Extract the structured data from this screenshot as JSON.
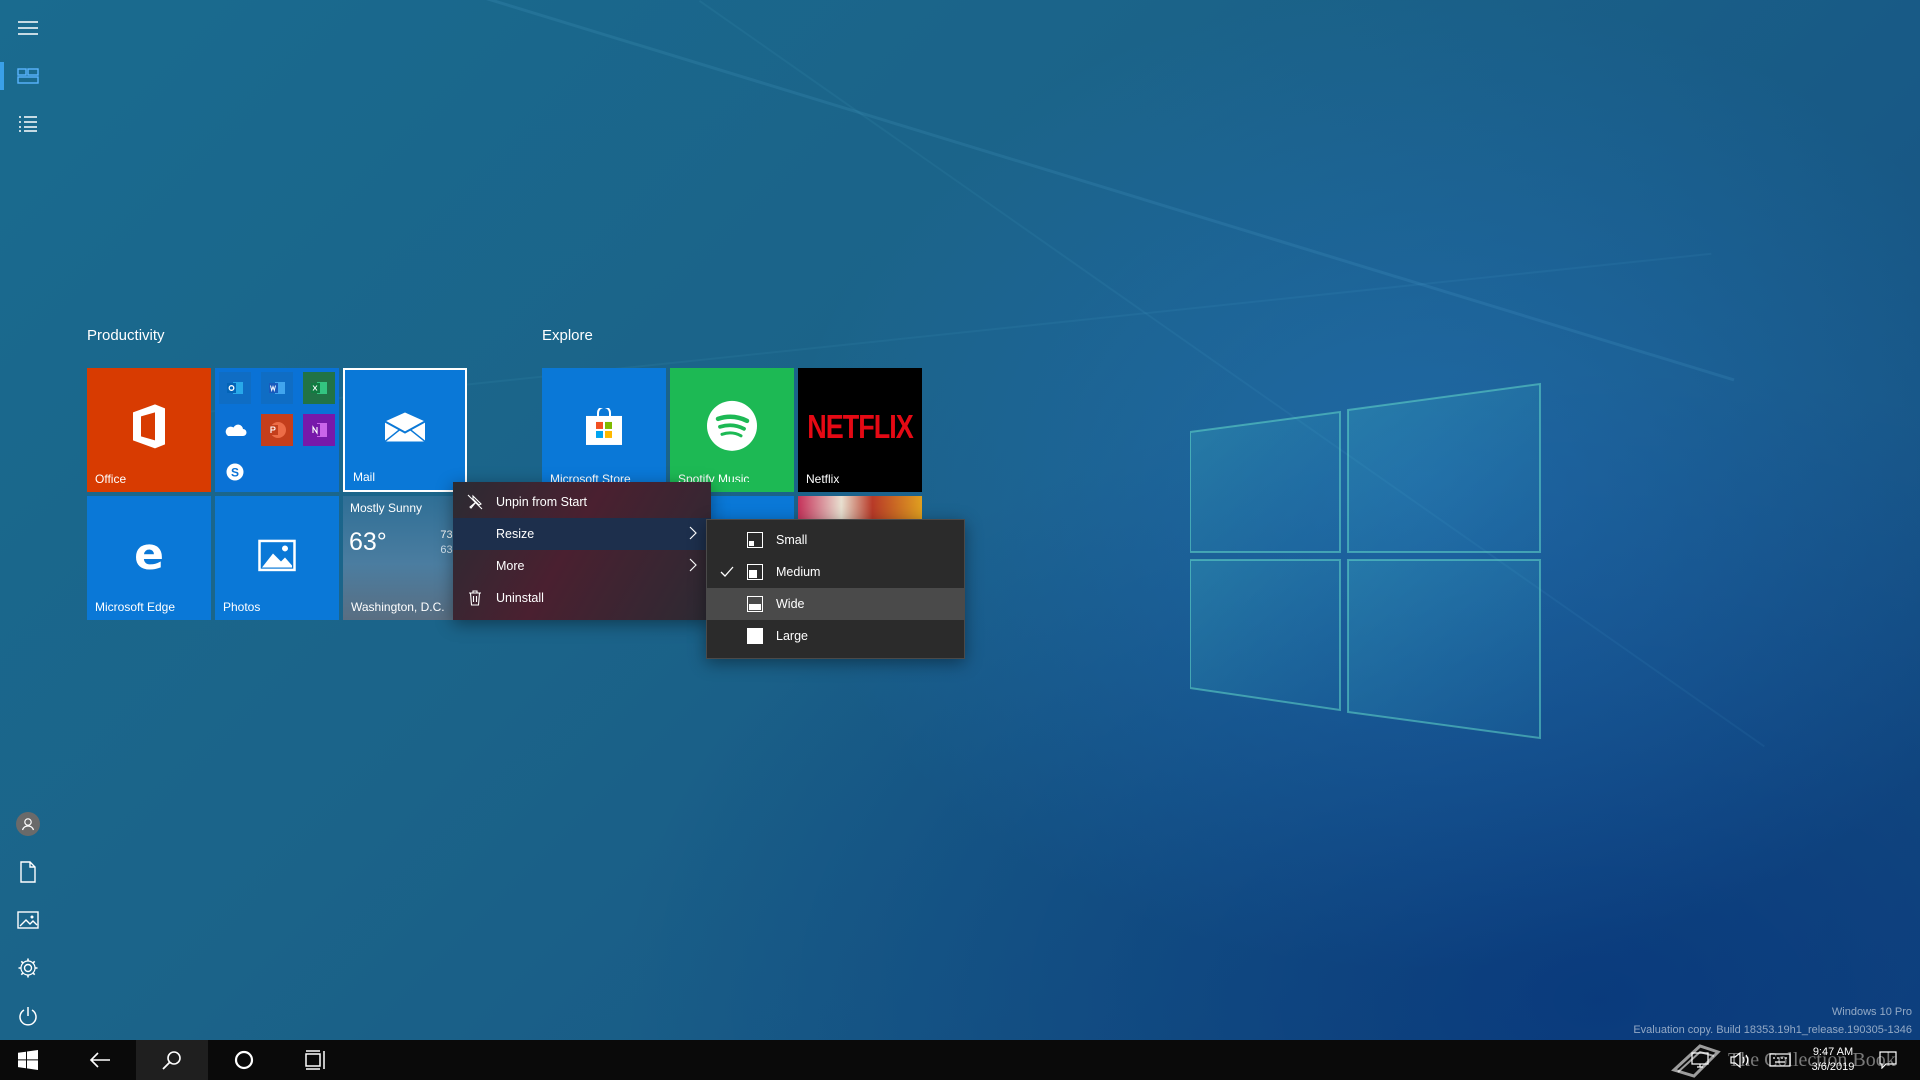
{
  "rail": {
    "items": [
      {
        "name": "hamburger-menu-icon"
      },
      {
        "name": "tiles-view-icon"
      },
      {
        "name": "all-apps-list-icon"
      },
      {
        "name": "user-avatar-icon"
      },
      {
        "name": "documents-icon"
      },
      {
        "name": "pictures-icon"
      },
      {
        "name": "settings-gear-icon"
      },
      {
        "name": "power-icon"
      }
    ]
  },
  "groups": {
    "productivity": {
      "title": "Productivity",
      "tiles": {
        "office": {
          "label": "Office",
          "color": "#d83b01"
        },
        "office_folder": {
          "label": "",
          "color": "#0a72d6"
        },
        "mail": {
          "label": "Mail",
          "color": "#0a78d7"
        },
        "edge": {
          "label": "Microsoft Edge",
          "color": "#0a78d7"
        },
        "photos": {
          "label": "Photos",
          "color": "#0a78d7"
        },
        "weather": {
          "condition": "Mostly Sunny",
          "temp": "63°",
          "high": "73°",
          "low": "63°",
          "location": "Washington, D.C."
        }
      }
    },
    "explore": {
      "title": "Explore",
      "tiles": {
        "store": {
          "label": "Microsoft Store",
          "color": "#0a78d7"
        },
        "spotify": {
          "label": "Spotify Music",
          "color": "#1db954"
        },
        "netflix": {
          "label": "Netflix",
          "wordmark": "NETFLIX",
          "color": "#000000"
        }
      }
    }
  },
  "context_menu": {
    "items": [
      {
        "label": "Unpin from Start",
        "icon": "unpin-icon",
        "has_submenu": false
      },
      {
        "label": "Resize",
        "icon": "",
        "has_submenu": true
      },
      {
        "label": "More",
        "icon": "",
        "has_submenu": true
      },
      {
        "label": "Uninstall",
        "icon": "trash-icon",
        "has_submenu": false
      }
    ]
  },
  "resize_submenu": {
    "items": [
      {
        "label": "Small",
        "checked": false
      },
      {
        "label": "Medium",
        "checked": true
      },
      {
        "label": "Wide",
        "checked": false,
        "hovered": true
      },
      {
        "label": "Large",
        "checked": false
      }
    ]
  },
  "watermark": {
    "edition": "Windows 10 Pro",
    "build": "Evaluation copy. Build 18353.19h1_release.190305-1346",
    "site": "The Collection Book"
  },
  "taskbar": {
    "time": "9:47 AM",
    "date": "3/6/2019"
  }
}
